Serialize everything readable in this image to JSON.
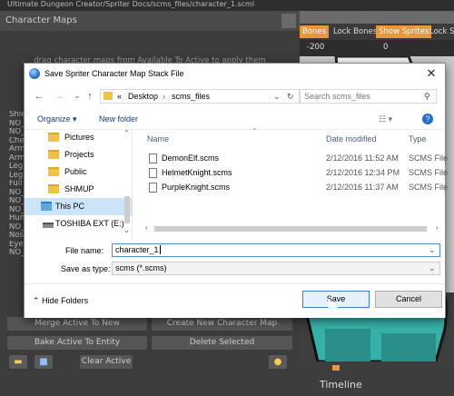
{
  "window_title_strip": "Character Maps",
  "background": {
    "top_strip": "Ultimate Dungeon Creator/Spriter Docs/scms_files/character_1.scml",
    "char_maps_title": "Character Maps",
    "hint_text": "drag character maps from Available To Active to apply them",
    "map_names": [
      "Shie",
      "NO_",
      "NO_",
      "Che",
      "Arm",
      "Arm",
      "Leg",
      "Leg",
      "Full",
      "NO_",
      "NO_",
      "NO_",
      "Hum",
      "NO_",
      "Nos",
      "Eyel",
      "NO_"
    ],
    "buttons": {
      "merge_active": "Merge Active To New",
      "create_new_map": "Create New Character Map",
      "bake_active": "Bake Active To Entity",
      "delete_selected": "Delete Selected",
      "clear_active": "Clear Active"
    },
    "toolbar": {
      "bones": "Bones",
      "lock_bones": "Lock Bones",
      "show_sprites": "Show Sprites",
      "lock_sprites": "Lock Sp"
    },
    "ruler": [
      "-200",
      "0"
    ],
    "timeline": "Timeline"
  },
  "dialog": {
    "title": "Save Spriter Character Map Stack File",
    "address": {
      "root": "«",
      "parts": [
        "Desktop",
        "scms_files"
      ]
    },
    "search_placeholder": "Search scms_files",
    "organize": "Organize",
    "new_folder": "New folder",
    "nav_items": [
      {
        "label": "Pictures",
        "type": "folder"
      },
      {
        "label": "Projects",
        "type": "folder"
      },
      {
        "label": "Public",
        "type": "folder"
      },
      {
        "label": "SHMUP",
        "type": "folder"
      },
      {
        "label": "This PC",
        "type": "pc"
      },
      {
        "label": "TOSHIBA EXT (E:)",
        "type": "drive"
      }
    ],
    "columns": {
      "name": "Name",
      "date": "Date modified",
      "type": "Type"
    },
    "files": [
      {
        "name": "DemonElf.scms",
        "date": "2/12/2016 11:52 AM",
        "type": "SCMS File"
      },
      {
        "name": "HelmetKnight.scms",
        "date": "2/12/2016 12:34 PM",
        "type": "SCMS File"
      },
      {
        "name": "PurpleKnight.scms",
        "date": "2/12/2016 11:37 AM",
        "type": "SCMS File"
      }
    ],
    "file_name_label": "File name:",
    "file_name_value": "character_1",
    "save_as_type_label": "Save as type:",
    "save_as_type_value": "scms (*.scms)",
    "hide_folders": "Hide Folders",
    "save": "Save",
    "cancel": "Cancel"
  },
  "colors": {
    "accent_orange": "#e8973a",
    "dialog_blue": "#3c7fd6",
    "folder_yellow": "#f1c24b"
  }
}
